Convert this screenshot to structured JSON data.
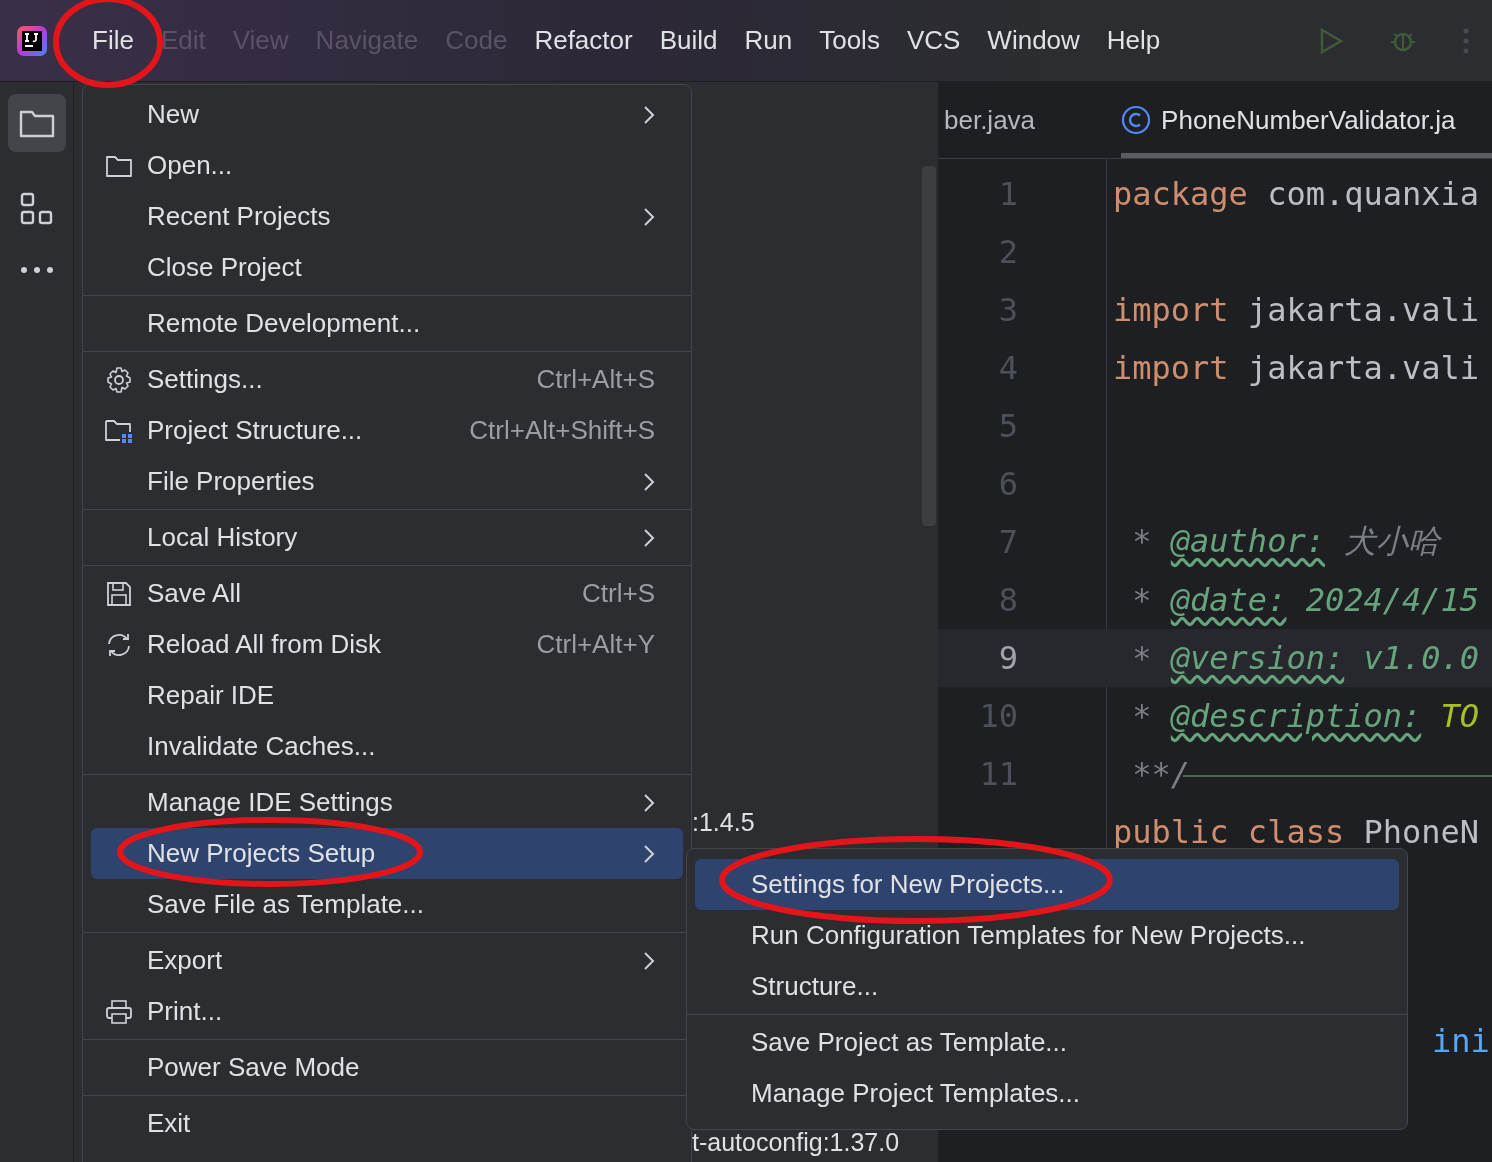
{
  "menubar": {
    "items": [
      {
        "label": "File",
        "obscured": false
      },
      {
        "label": "Edit",
        "obscured": true
      },
      {
        "label": "View",
        "obscured": true
      },
      {
        "label": "Navigate",
        "obscured": true
      },
      {
        "label": "Code",
        "obscured": true
      },
      {
        "label": "Refactor",
        "obscured": false
      },
      {
        "label": "Build",
        "obscured": false
      },
      {
        "label": "Run",
        "obscured": false
      },
      {
        "label": "Tools",
        "obscured": false
      },
      {
        "label": "VCS",
        "obscured": false
      },
      {
        "label": "Window",
        "obscured": false
      },
      {
        "label": "Help",
        "obscured": false
      }
    ]
  },
  "background_texts": [
    ":1.4.5",
    "t-autoconfig:1.37.0"
  ],
  "editor": {
    "tabs": [
      {
        "label": "ber.java",
        "selected": false
      },
      {
        "label": "PhoneNumberValidator.ja",
        "selected": true
      }
    ],
    "lines": [
      {
        "number": "1",
        "current": false,
        "tokens": [
          {
            "kind": "keyword",
            "text": "package"
          },
          {
            "kind": "plain",
            "text": " com.quanxia"
          }
        ]
      },
      {
        "number": "2",
        "current": false
      },
      {
        "number": "3",
        "current": false,
        "tokens": [
          {
            "kind": "keyword",
            "text": "import"
          },
          {
            "kind": "plain",
            "text": " jakarta.vali"
          }
        ]
      },
      {
        "number": "4",
        "current": false,
        "tokens": [
          {
            "kind": "keyword",
            "text": "import"
          },
          {
            "kind": "plain",
            "text": " jakarta.vali"
          }
        ]
      },
      {
        "number": "5",
        "current": false
      },
      {
        "number": "6",
        "current": false
      },
      {
        "number": "7",
        "current": false,
        "tokens": [
          {
            "kind": "doc",
            "text": " * "
          },
          {
            "kind": "tag",
            "text": "@author:"
          },
          {
            "kind": "doc",
            "text": " 犬小哈"
          }
        ]
      },
      {
        "number": "8",
        "current": false,
        "tokens": [
          {
            "kind": "doc",
            "text": " * "
          },
          {
            "kind": "tag",
            "text": "@date:"
          },
          {
            "kind": "value",
            "text": " 2024/4/15"
          }
        ]
      },
      {
        "number": "9",
        "current": true,
        "tokens": [
          {
            "kind": "doc",
            "text": " * "
          },
          {
            "kind": "tag",
            "text": "@version:"
          },
          {
            "kind": "value",
            "text": " v1.0.0"
          }
        ]
      },
      {
        "number": "10",
        "current": false,
        "tokens": [
          {
            "kind": "doc",
            "text": " * "
          },
          {
            "kind": "tag",
            "text": "@description:"
          },
          {
            "kind": "todo",
            "text": " TO"
          }
        ]
      },
      {
        "number": "11",
        "current": false,
        "tokens": [
          {
            "kind": "doc",
            "text": " **/"
          }
        ]
      },
      {
        "current": false,
        "tokens": [
          {
            "kind": "keyword",
            "text": "public class"
          },
          {
            "kind": "plain",
            "text": " PhoneN"
          }
        ]
      }
    ],
    "partial_code": "ini"
  },
  "file_menu": {
    "groups": [
      [
        {
          "label": "New",
          "has_submenu": true,
          "selected": false
        },
        {
          "label": "Open...",
          "has_submenu": false,
          "selected": false
        },
        {
          "label": "Recent Projects",
          "has_submenu": true,
          "selected": false
        },
        {
          "label": "Close Project",
          "has_submenu": false,
          "selected": false
        }
      ],
      [
        {
          "label": "Remote Development...",
          "has_submenu": false,
          "selected": false
        }
      ],
      [
        {
          "label": "Settings...",
          "shortcut": "Ctrl+Alt+S",
          "has_submenu": false,
          "selected": false
        },
        {
          "label": "Project Structure...",
          "shortcut": "Ctrl+Alt+Shift+S",
          "has_submenu": false,
          "selected": false
        },
        {
          "label": "File Properties",
          "has_submenu": true,
          "selected": false
        }
      ],
      [
        {
          "label": "Local History",
          "has_submenu": true,
          "selected": false
        }
      ],
      [
        {
          "label": "Save All",
          "shortcut": "Ctrl+S",
          "has_submenu": false,
          "selected": false
        },
        {
          "label": "Reload All from Disk",
          "shortcut": "Ctrl+Alt+Y",
          "has_submenu": false,
          "selected": false
        },
        {
          "label": "Repair IDE",
          "has_submenu": false,
          "selected": false
        },
        {
          "label": "Invalidate Caches...",
          "has_submenu": false,
          "selected": false
        }
      ],
      [
        {
          "label": "Manage IDE Settings",
          "has_submenu": true,
          "selected": false
        },
        {
          "label": "New Projects Setup",
          "has_submenu": true,
          "selected": true
        },
        {
          "label": "Save File as Template...",
          "has_submenu": false,
          "selected": false
        }
      ],
      [
        {
          "label": "Export",
          "has_submenu": true,
          "selected": false
        },
        {
          "label": "Print...",
          "has_submenu": false,
          "selected": false
        }
      ],
      [
        {
          "label": "Power Save Mode",
          "has_submenu": false,
          "selected": false
        }
      ],
      [
        {
          "label": "Exit",
          "has_submenu": false,
          "selected": false
        }
      ]
    ]
  },
  "submenu": {
    "groups": [
      [
        {
          "label": "Settings for New Projects...",
          "selected": true
        },
        {
          "label": "Run Configuration Templates for New Projects...",
          "selected": false
        },
        {
          "label": "Structure...",
          "selected": false
        }
      ],
      [
        {
          "label": "Save Project as Template...",
          "selected": false
        },
        {
          "label": "Manage Project Templates...",
          "selected": false
        }
      ]
    ]
  }
}
